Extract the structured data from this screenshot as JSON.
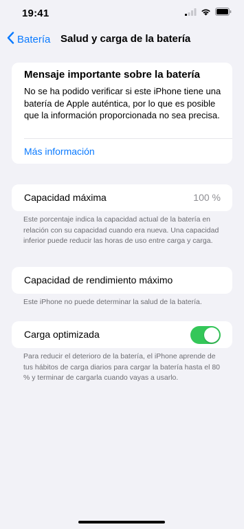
{
  "status_bar": {
    "time": "19:41",
    "icons": [
      "signal-icon",
      "wifi-icon",
      "battery-icon"
    ]
  },
  "nav": {
    "back_label": "Batería",
    "title": "Salud y carga de la batería"
  },
  "important": {
    "title": "Mensaje importante sobre la batería",
    "body": "No se ha podido verificar si este iPhone tiene una batería de Apple auténtica, por lo que es posible que la información proporcionada no sea precisa.",
    "link": "Más información"
  },
  "max_capacity": {
    "label": "Capacidad máxima",
    "value": "100 %",
    "footnote": "Este porcentaje indica la capacidad actual de la batería en relación con su capacidad cuando era nueva. Una capacidad inferior puede reducir las horas de uso entre carga y carga."
  },
  "peak_performance": {
    "label": "Capacidad de rendimiento máximo",
    "footnote": "Este iPhone no puede determinar la salud de la batería."
  },
  "optimized_charging": {
    "label": "Carga optimizada",
    "enabled": true,
    "footnote": "Para reducir el deterioro de la batería, el iPhone aprende de tus hábitos de carga diarios para cargar la batería hasta el 80 % y terminar de cargarla cuando vayas a usarlo."
  },
  "colors": {
    "accent": "#0a7aff",
    "toggle_on": "#34c759",
    "background": "#f2f2f7"
  }
}
